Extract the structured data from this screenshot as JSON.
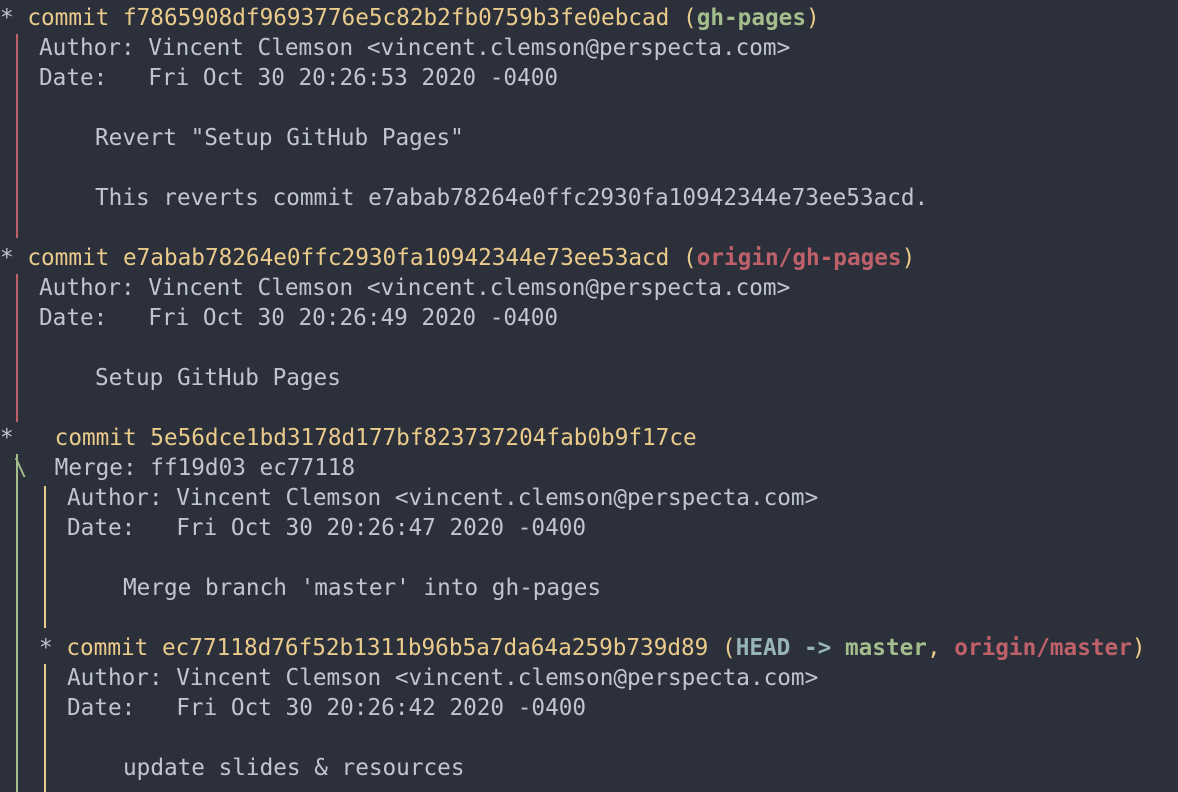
{
  "colors": {
    "background": "#2b303b",
    "foreground": "#c0c5ce",
    "graph_red": "#bf616a",
    "graph_green": "#a3be8c",
    "graph_yellow": "#ebcb8b",
    "ref_branch": "#a3be8c",
    "ref_remote": "#bf616a",
    "ref_head": "#96b5b4"
  },
  "commits": [
    {
      "keyword": "commit",
      "hash": "f7865908df9693776e5c82b2fb0759b3fe0ebcad",
      "open_paren": "(",
      "refs": [
        {
          "label": "gh-pages",
          "kind": "branch"
        }
      ],
      "close_paren": ")",
      "author": "Author: Vincent Clemson <vincent.clemson@perspecta.com>",
      "date": "Date:   Fri Oct 30 20:26:53 2020 -0400",
      "message": [
        "Revert \"Setup GitHub Pages\"",
        "This reverts commit e7abab78264e0ffc2930fa10942344e73ee53acd."
      ]
    },
    {
      "keyword": "commit",
      "hash": "e7abab78264e0ffc2930fa10942344e73ee53acd",
      "open_paren": "(",
      "refs": [
        {
          "label": "origin/gh-pages",
          "kind": "remote"
        }
      ],
      "close_paren": ")",
      "author": "Author: Vincent Clemson <vincent.clemson@perspecta.com>",
      "date": "Date:   Fri Oct 30 20:26:49 2020 -0400",
      "message": [
        "Setup GitHub Pages"
      ]
    },
    {
      "keyword": "commit",
      "hash": "5e56dce1bd3178d177bf823737204fab0b9f17ce",
      "merge": "Merge: ff19d03 ec77118",
      "author": "Author: Vincent Clemson <vincent.clemson@perspecta.com>",
      "date": "Date:   Fri Oct 30 20:26:47 2020 -0400",
      "message": [
        "Merge branch 'master' into gh-pages"
      ]
    },
    {
      "keyword": "commit",
      "hash": "ec77118d76f52b1311b96b5a7da64a259b739d89",
      "open_paren": "(",
      "refs": [
        {
          "label": "HEAD -> ",
          "kind": "head"
        },
        {
          "label": "master",
          "kind": "branch"
        },
        {
          "label": ", ",
          "kind": "sep"
        },
        {
          "label": "origin/master",
          "kind": "remote"
        }
      ],
      "close_paren": ")",
      "author": "Author: Vincent Clemson <vincent.clemson@perspecta.com>",
      "date": "Date:   Fri Oct 30 20:26:42 2020 -0400",
      "message": [
        "update slides & resources"
      ]
    }
  ],
  "graph": {
    "star": "*",
    "merge_branch": "\\"
  }
}
